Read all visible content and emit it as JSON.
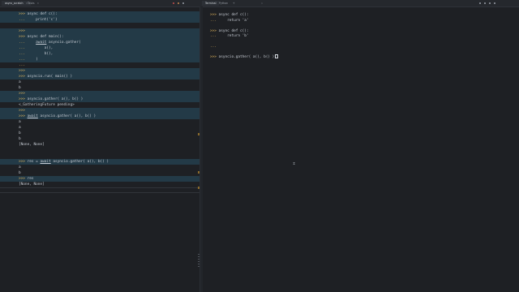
{
  "tabs": [
    {
      "label": "async_scratch",
      "active": true
    },
    {
      "label": "Tasks",
      "active": false
    }
  ],
  "right_tabs": [
    {
      "label": "Terminal",
      "active": true
    },
    {
      "label": "Python",
      "active": false
    },
    {
      "label": "+",
      "active": false
    }
  ],
  "colors": {
    "background": "#1e2024",
    "highlight": "#233a47",
    "prompt": "#e0b45c",
    "text": "#c7ccd4"
  },
  "left_lines": [
    {
      "prompt": ">>>",
      "code": " async def c():",
      "hl": true
    },
    {
      "prompt": "...",
      "code": "     print('c')",
      "hl": true
    },
    {
      "prompt": "",
      "code": "",
      "hl": false
    },
    {
      "prompt": ">>>",
      "code": "",
      "hl": true
    },
    {
      "prompt": ">>>",
      "code": " async def main():",
      "hl": true
    },
    {
      "prompt": "...",
      "code": "     await asyncio.gather(",
      "hl": true
    },
    {
      "prompt": "...",
      "code": "         a(),",
      "hl": true
    },
    {
      "prompt": "...",
      "code": "         b(),",
      "hl": true
    },
    {
      "prompt": "...",
      "code": "     )",
      "hl": true
    },
    {
      "prompt": "...",
      "code": "",
      "hl": false
    },
    {
      "prompt": ">>>",
      "code": "",
      "hl": true
    },
    {
      "prompt": ">>>",
      "code": " asyncio.run( main() )",
      "hl": true
    },
    {
      "prompt": "",
      "code": "a",
      "hl": false
    },
    {
      "prompt": "",
      "code": "b",
      "hl": false
    },
    {
      "prompt": ">>>",
      "code": "",
      "hl": true
    },
    {
      "prompt": ">>>",
      "code": " asyncio.gather( a(), b() )",
      "hl": true
    },
    {
      "prompt": "",
      "code": "<_GatheringFuture pending>",
      "hl": false
    },
    {
      "prompt": ">>>",
      "code": "",
      "hl": true
    },
    {
      "prompt": ">>>",
      "code": " await asyncio.gather( a(), b() )",
      "hl": true
    },
    {
      "prompt": "",
      "code": "a",
      "hl": false
    },
    {
      "prompt": "",
      "code": "a",
      "hl": false
    },
    {
      "prompt": "",
      "code": "b",
      "hl": false
    },
    {
      "prompt": "",
      "code": "b",
      "hl": false
    },
    {
      "prompt": "",
      "code": "[None, None]",
      "hl": false
    },
    {
      "prompt": "",
      "code": "",
      "hl": false
    },
    {
      "prompt": "",
      "code": "",
      "hl": false
    },
    {
      "prompt": ">>>",
      "code": " res = await asyncio.gather( a(), b() )",
      "hl": true
    },
    {
      "prompt": "",
      "code": "a",
      "hl": false
    },
    {
      "prompt": "",
      "code": "b",
      "hl": false
    },
    {
      "prompt": ">>>",
      "code": " res",
      "hl": true
    },
    {
      "prompt": "",
      "code": "[None, None]",
      "hl": false
    }
  ],
  "right_lines": [
    {
      "prompt": ">>>",
      "code": " async def c():"
    },
    {
      "prompt": "...",
      "code": "     return 'a'"
    },
    {
      "prompt": "",
      "code": ""
    },
    {
      "prompt": ">>>",
      "code": " async def c():"
    },
    {
      "prompt": "...",
      "code": "     return 'b'"
    },
    {
      "prompt": "",
      "code": ""
    },
    {
      "prompt": "...",
      "code": ""
    },
    {
      "prompt": "",
      "code": ""
    },
    {
      "prompt": ">>>",
      "code": " asyncio.gather( a(), b() )"
    }
  ]
}
